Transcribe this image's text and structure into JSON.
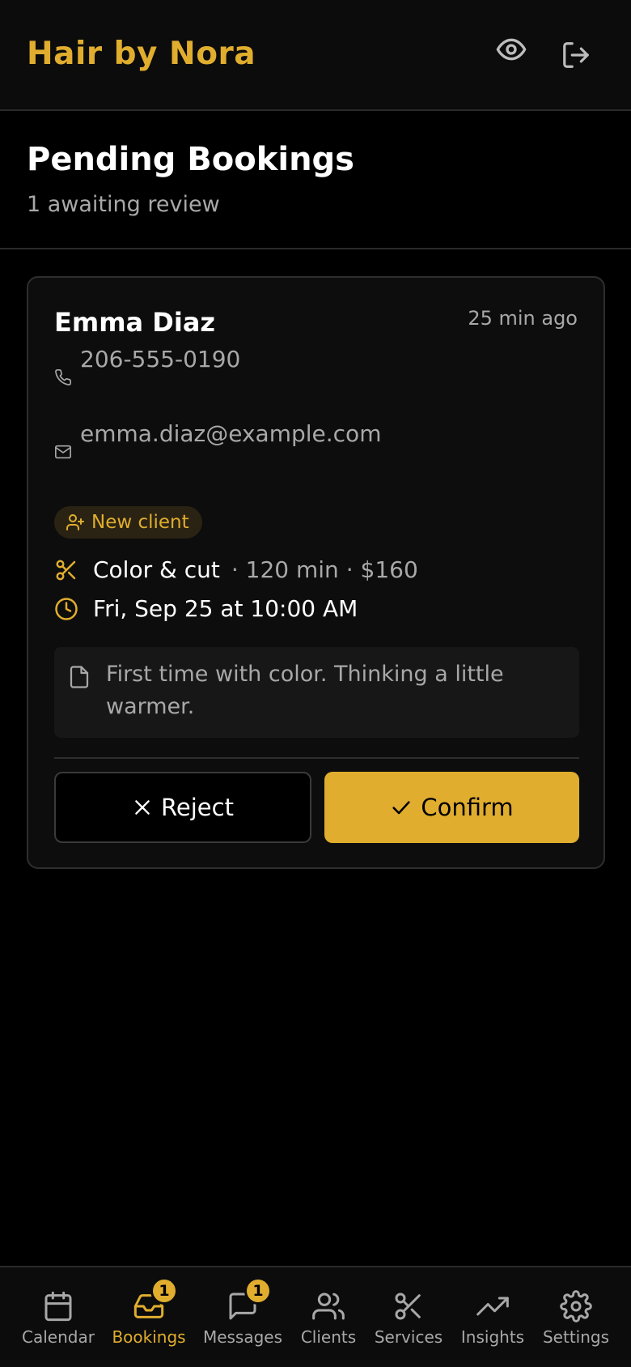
{
  "header": {
    "brand": "Hair by Nora",
    "preview_icon": "eye-icon",
    "logout_icon": "logout-icon"
  },
  "page": {
    "title": "Pending Bookings",
    "subtitle": "1 awaiting review"
  },
  "booking": {
    "client_name": "Emma Diaz",
    "time_ago": "25 min ago",
    "phone": "206-555-0190",
    "email": "emma.diaz@example.com",
    "badge": "New client",
    "service": "Color & cut",
    "service_meta": "· 120 min · $160",
    "datetime": "Fri, Sep 25 at 10:00 AM",
    "note": "First time with color. Thinking a little warmer.",
    "reject_label": "Reject",
    "confirm_label": "Confirm"
  },
  "nav": {
    "items": [
      {
        "label": "Calendar",
        "icon": "calendar-icon"
      },
      {
        "label": "Bookings",
        "icon": "inbox-icon",
        "badge": "1",
        "active": true
      },
      {
        "label": "Messages",
        "icon": "chat-icon",
        "badge": "1"
      },
      {
        "label": "Clients",
        "icon": "users-icon"
      },
      {
        "label": "Services",
        "icon": "scissors-icon"
      },
      {
        "label": "Insights",
        "icon": "trending-icon"
      },
      {
        "label": "Settings",
        "icon": "gear-icon"
      }
    ]
  },
  "colors": {
    "accent": "#e0ad2e",
    "background": "#000000",
    "muted": "#a8a8a8"
  }
}
